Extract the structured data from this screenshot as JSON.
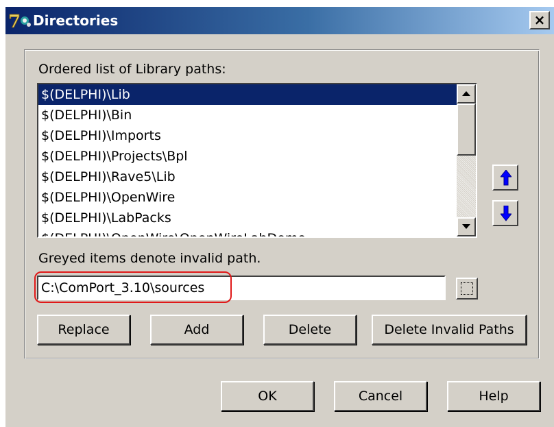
{
  "window": {
    "title": "Directories",
    "close_label": "×"
  },
  "library": {
    "label": "Ordered list of Library paths:",
    "items": [
      "$(DELPHI)\\Lib",
      "$(DELPHI)\\Bin",
      "$(DELPHI)\\Imports",
      "$(DELPHI)\\Projects\\Bpl",
      "$(DELPHI)\\Rave5\\Lib",
      "$(DELPHI)\\OpenWire",
      "$(DELPHI)\\LabPacks",
      "$(DELPHI)\\OpenWire\\OpenWireLabDemo"
    ],
    "selected_index": 0,
    "note": "Greyed items denote invalid path."
  },
  "path_input": {
    "value": "C:\\ComPort_3.10\\sources"
  },
  "buttons": {
    "replace": "Replace",
    "add": "Add",
    "delete": "Delete",
    "delete_invalid": "Delete Invalid Paths",
    "ok": "OK",
    "cancel": "Cancel",
    "help": "Help"
  },
  "icons": {
    "app": "app-7-icon",
    "move_up": "blue-up-arrow-icon",
    "move_down": "blue-down-arrow-icon",
    "browse": "ellipsis-browse-icon"
  },
  "colors": {
    "titlebar_start": "#0a246a",
    "titlebar_end": "#a6caf0",
    "selection": "#0a246a",
    "arrow_blue": "#0000ff",
    "highlight_red": "#e01818"
  }
}
